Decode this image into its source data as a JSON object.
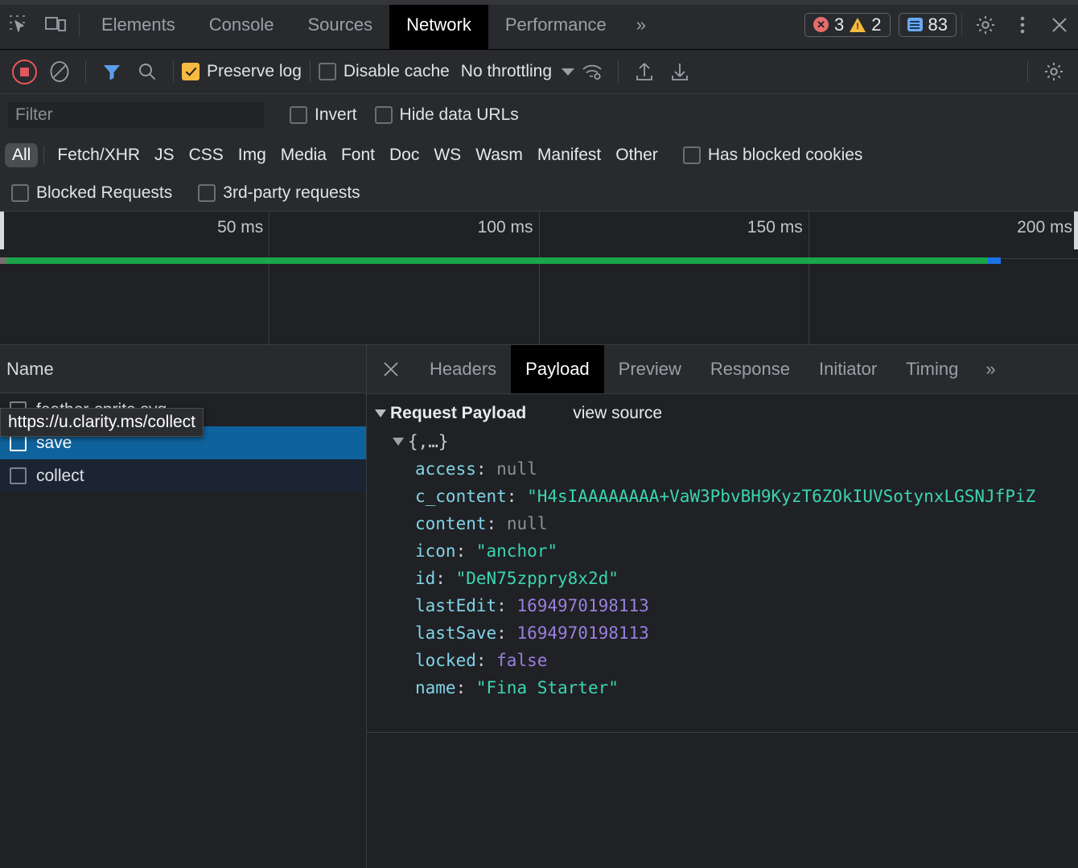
{
  "window": {
    "title": "DevTools - Network"
  },
  "tabbar": {
    "inspect_icon": "inspect-element-icon",
    "device_icon": "device-toolbar-icon",
    "tabs": [
      {
        "label": "Elements",
        "active": false
      },
      {
        "label": "Console",
        "active": false
      },
      {
        "label": "Sources",
        "active": false
      },
      {
        "label": "Network",
        "active": true
      },
      {
        "label": "Performance",
        "active": false
      }
    ],
    "more_label": "»",
    "counters": {
      "errors": "3",
      "warnings": "2",
      "messages": "83"
    },
    "settings_icon": "gear-icon",
    "menu_icon": "kebab-menu-icon",
    "close_icon": "close-icon"
  },
  "network_toolbar": {
    "record_icon": "record-stop-icon",
    "clear_icon": "clear-icon",
    "filter_icon": "filter-funnel-icon",
    "search_icon": "search-icon",
    "preserve_log": {
      "label": "Preserve log",
      "checked": true
    },
    "disable_cache": {
      "label": "Disable cache",
      "checked": false
    },
    "throttling": {
      "value": "No throttling"
    },
    "network_conditions_icon": "wifi-settings-icon",
    "import_icon": "import-har-icon",
    "export_icon": "export-har-icon",
    "settings_icon": "network-settings-gear-icon"
  },
  "filter_row": {
    "filter_placeholder": "Filter",
    "filter_value": "",
    "invert": {
      "label": "Invert",
      "checked": false
    },
    "hide_data_urls": {
      "label": "Hide data URLs",
      "checked": false
    }
  },
  "type_filters": {
    "items": [
      {
        "label": "All",
        "active": true
      },
      {
        "label": "Fetch/XHR",
        "active": false
      },
      {
        "label": "JS",
        "active": false
      },
      {
        "label": "CSS",
        "active": false
      },
      {
        "label": "Img",
        "active": false
      },
      {
        "label": "Media",
        "active": false
      },
      {
        "label": "Font",
        "active": false
      },
      {
        "label": "Doc",
        "active": false
      },
      {
        "label": "WS",
        "active": false
      },
      {
        "label": "Wasm",
        "active": false
      },
      {
        "label": "Manifest",
        "active": false
      },
      {
        "label": "Other",
        "active": false
      }
    ],
    "has_blocked_cookies": {
      "label": "Has blocked cookies",
      "checked": false
    }
  },
  "extra_filters": {
    "blocked_requests": {
      "label": "Blocked Requests",
      "checked": false
    },
    "third_party_requests": {
      "label": "3rd-party requests",
      "checked": false
    }
  },
  "overview": {
    "ticks": [
      "50 ms",
      "100 ms",
      "150 ms",
      "200 ms"
    ],
    "bar_green_color": "#1aa54a",
    "bar_blue_color": "#1a73e8"
  },
  "requests_pane": {
    "column_header": "Name",
    "tooltip": "https://u.clarity.ms/collect",
    "rows": [
      {
        "name": "feather-sprite.svg",
        "state": "plain"
      },
      {
        "name": "save",
        "state": "selected"
      },
      {
        "name": "collect",
        "state": "alt"
      }
    ]
  },
  "detail_pane": {
    "close_icon": "close-icon",
    "tabs": [
      {
        "label": "Headers",
        "active": false
      },
      {
        "label": "Payload",
        "active": true
      },
      {
        "label": "Preview",
        "active": false
      },
      {
        "label": "Response",
        "active": false
      },
      {
        "label": "Initiator",
        "active": false
      },
      {
        "label": "Timing",
        "active": false
      }
    ],
    "more_label": "»",
    "payload": {
      "section_title": "Request Payload",
      "view_source": "view source",
      "object_label": "{,…}",
      "fields": [
        {
          "key": "access",
          "value": "null",
          "type": "null"
        },
        {
          "key": "c_content",
          "value": "\"H4sIAAAAAAAA+VaW3PbvBH9KyzT6ZOkIUVSotynxLGSNJfPiZ",
          "type": "string"
        },
        {
          "key": "content",
          "value": "null",
          "type": "null"
        },
        {
          "key": "icon",
          "value": "\"anchor\"",
          "type": "string"
        },
        {
          "key": "id",
          "value": "\"DeN75zppry8x2d\"",
          "type": "string"
        },
        {
          "key": "lastEdit",
          "value": "1694970198113",
          "type": "number"
        },
        {
          "key": "lastSave",
          "value": "1694970198113",
          "type": "number"
        },
        {
          "key": "locked",
          "value": "false",
          "type": "boolean"
        },
        {
          "key": "name",
          "value": "\"Fina Starter\"",
          "type": "string"
        }
      ]
    }
  }
}
